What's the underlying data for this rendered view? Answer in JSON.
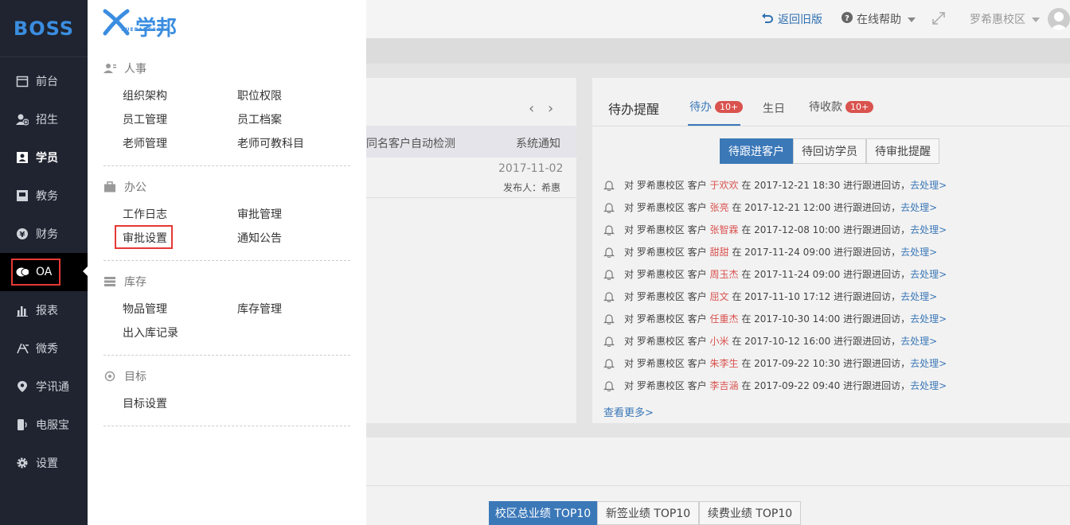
{
  "sidebar": {
    "logo": "BOSS",
    "items": [
      {
        "label": "前台",
        "icon": "calendar-icon"
      },
      {
        "label": "招生",
        "icon": "user-plus-icon"
      },
      {
        "label": "学员",
        "icon": "user-card-icon"
      },
      {
        "label": "教务",
        "icon": "book-icon"
      },
      {
        "label": "财务",
        "icon": "yen-icon"
      },
      {
        "label": "OA",
        "icon": "chat-icon"
      },
      {
        "label": "报表",
        "icon": "bar-chart-icon"
      },
      {
        "label": "微秀",
        "icon": "xiu-icon"
      },
      {
        "label": "学讯通",
        "icon": "location-pin-icon"
      },
      {
        "label": "电服宝",
        "icon": "phone-icon"
      },
      {
        "label": "设置",
        "icon": "gear-icon"
      }
    ]
  },
  "menu": {
    "brand": "学邦",
    "brand_sub": "XUEBANGSOFT",
    "sections": [
      {
        "title": "人事",
        "icon": "person-list-icon",
        "items": [
          "组织架构",
          "职位权限",
          "员工管理",
          "员工档案",
          "老师管理",
          "老师可教科目"
        ]
      },
      {
        "title": "办公",
        "icon": "briefcase-icon",
        "items": [
          "工作日志",
          "审批管理",
          "审批设置",
          "通知公告"
        ]
      },
      {
        "title": "库存",
        "icon": "stack-icon",
        "items": [
          "物品管理",
          "库存管理",
          "出入库记录"
        ]
      },
      {
        "title": "目标",
        "icon": "target-icon",
        "items": [
          "目标设置"
        ]
      }
    ]
  },
  "header": {
    "back_old": "返回旧版",
    "help": "在线帮助",
    "campus": "罗希惠校区"
  },
  "announce": {
    "title": "同名客户自动检测",
    "type": "系统通知",
    "date": "2017-11-02",
    "publisher": "发布人：希惠"
  },
  "todo": {
    "title": "待办提醒",
    "tabs": [
      {
        "label": "待办",
        "badge": "10+"
      },
      {
        "label": "生日",
        "badge": ""
      },
      {
        "label": "待收款",
        "badge": "10+"
      }
    ],
    "segments": [
      "待跟进客户",
      "待回访学员",
      "待审批提醒"
    ],
    "prefix": "对 罗希惠校区 客户",
    "suffix": "进行跟进回访，",
    "action": "去处理>",
    "items": [
      {
        "name": "于欢欢",
        "time": "在 2017-12-21 18:30"
      },
      {
        "name": "张亮",
        "time": "在 2017-12-21 12:00"
      },
      {
        "name": "张智霖",
        "time": "在 2017-12-08 10:00"
      },
      {
        "name": "甜甜",
        "time": "在 2017-11-24 09:00"
      },
      {
        "name": "周玉杰",
        "time": "在 2017-11-24 09:00"
      },
      {
        "name": "屈文",
        "time": "在 2017-11-10 17:12"
      },
      {
        "name": "任重杰",
        "time": "在 2017-10-30 14:00"
      },
      {
        "name": "小米",
        "time": "在 2017-10-12 16:00"
      },
      {
        "name": "朱李生",
        "time": "在 2017-09-22 10:30"
      },
      {
        "name": "李吉涵",
        "time": "在 2017-09-22 09:40"
      }
    ],
    "more": "查看更多>"
  },
  "bottom_tabs": [
    "校区总业绩 TOP10",
    "新签业绩 TOP10",
    "续费业绩 TOP10"
  ],
  "colors": {
    "accent": "#3b8de0",
    "sidebar": "#1f2430",
    "highlight": "#e53935",
    "badge": "#d9534f"
  }
}
